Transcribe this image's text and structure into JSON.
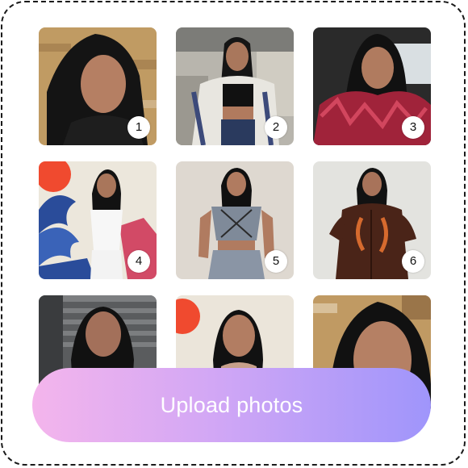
{
  "upload_panel": {
    "button_label": "Upload photos",
    "photos": [
      {
        "number": "1",
        "scene": "portrait-selfie-brick-wall"
      },
      {
        "number": "2",
        "scene": "outdoor-crop-top-striped-jacket"
      },
      {
        "number": "3",
        "scene": "car-seat-red-fur-coat"
      },
      {
        "number": "4",
        "scene": "wave-mural-white-top"
      },
      {
        "number": "5",
        "scene": "denim-lace-up-outfit"
      },
      {
        "number": "6",
        "scene": "brown-velour-tracksuit"
      },
      {
        "number": "",
        "scene": "blinds-background-portrait"
      },
      {
        "number": "",
        "scene": "red-sun-mural-portrait"
      },
      {
        "number": "",
        "scene": "close-up-brick-wall-portrait"
      }
    ]
  },
  "colors": {
    "button_gradient_start": "#f4b5ec",
    "button_gradient_end": "#9f95fb",
    "border": "#1a1a1a"
  }
}
